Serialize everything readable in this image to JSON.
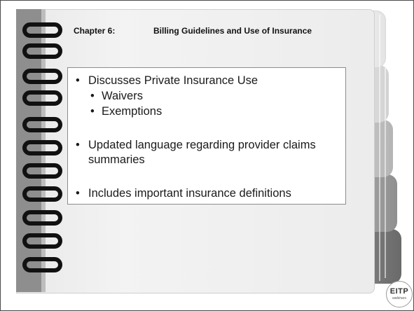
{
  "slide": {
    "chapter_label": "Chapter 6:",
    "chapter_title": "Billing Guidelines and Use of Insurance",
    "bullets": {
      "b1": "Discusses Private Insurance Use",
      "b1_sub1": "Waivers",
      "b1_sub2": "Exemptions",
      "b2_line1": "Updated language regarding provider claims",
      "b2_line2": "summaries",
      "b3": "Includes important insurance definitions"
    },
    "bullet_glyph": "•"
  },
  "logo": {
    "text": "EITP",
    "subtext": "webinars"
  },
  "colors": {
    "spine": "#8e8e8e",
    "ring": "#111111",
    "page": "#ececec"
  }
}
